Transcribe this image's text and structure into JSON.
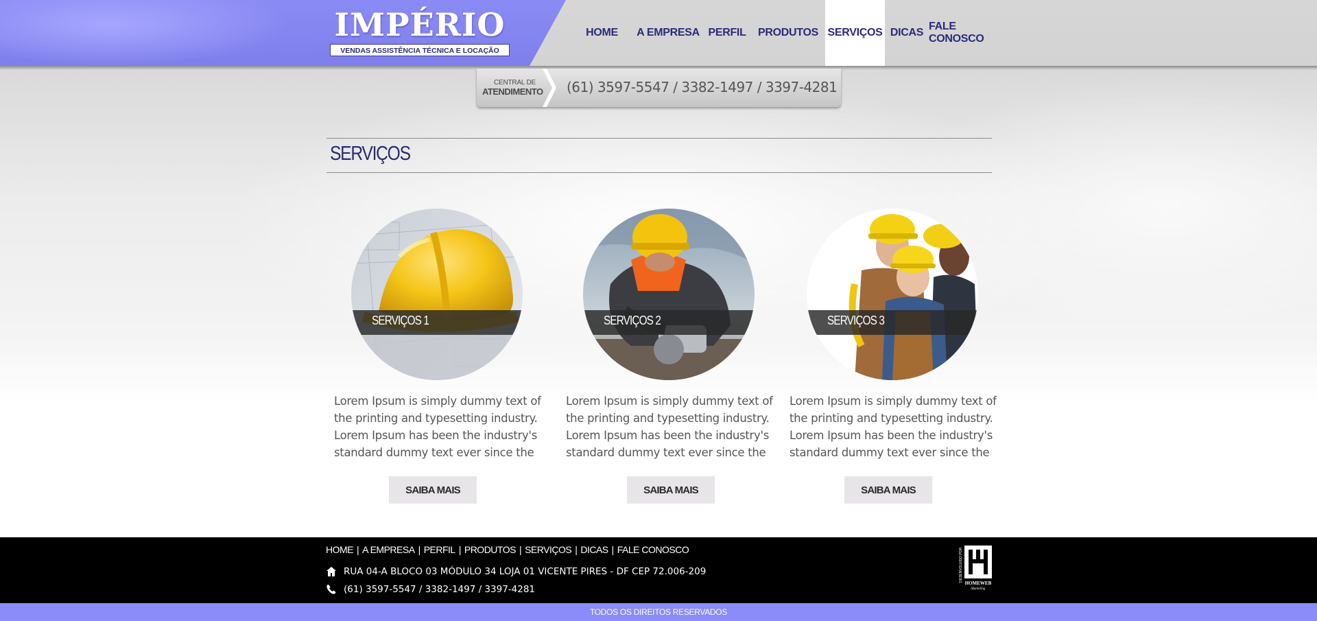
{
  "header": {
    "logo_title": "IMPÉRIO",
    "logo_tagline": "VENDAS ASSISTÊNCIA TÉCNICA E LOCAÇÃO",
    "nav": [
      {
        "label": "HOME",
        "active": false
      },
      {
        "label": "A EMPRESA",
        "active": false
      },
      {
        "label": "PERFIL",
        "active": false
      },
      {
        "label": "PRODUTOS",
        "active": false
      },
      {
        "label": "SERVIÇOS",
        "active": true
      },
      {
        "label": "DICAS",
        "active": false
      },
      {
        "label": "FALE CONOSCO",
        "active": false
      }
    ]
  },
  "contact_bar": {
    "label_line1": "CENTRAL DE",
    "label_line2": "ATENDIMENTO",
    "phones": "(61) 3597-5547 / 3382-1497 / 3397-4281"
  },
  "section": {
    "title": "SERVIÇOS"
  },
  "services": [
    {
      "label": "SERVIÇOS 1",
      "image": "hardhat-blueprint-photo",
      "text": "Lorem Ipsum is simply dummy text of the printing and typesetting industry. Lorem Ipsum has been the industry's standard dummy text ever since the",
      "button": "SAIBA MAIS"
    },
    {
      "label": "SERVIÇOS 2",
      "image": "construction-worker-photo",
      "text": "Lorem Ipsum is simply dummy text of the printing and typesetting industry. Lorem Ipsum has been the industry's standard dummy text ever since the",
      "button": "SAIBA MAIS"
    },
    {
      "label": "SERVIÇOS 3",
      "image": "workers-team-photo",
      "text": "Lorem Ipsum is simply dummy text of the printing and typesetting industry. Lorem Ipsum has been the industry's standard dummy text ever since the",
      "button": "SAIBA MAIS"
    }
  ],
  "footer": {
    "nav": [
      "HOME",
      "A EMPRESA",
      "PERFIL",
      "PRODUTOS",
      "SERVIÇOS",
      "DICAS",
      "FALE CONOSCO"
    ],
    "separator": "|",
    "address": "RUA 04-A BLOCO 03 MÓDULO 34 LOJA 01 VICENTE PIRES - DF CEP 72.006-209",
    "phones": "(61) 3597-5547 / 3382-1497 / 3397-4281",
    "dev_logo": {
      "vertical_text": "DESENVOLVIDO POR",
      "name": "HOMEWEB",
      "sub": "Marketing"
    },
    "copyright": "TODOS OS DIREITOS RESERVADOS"
  },
  "colors": {
    "brand_purple": "#8b8bf5",
    "nav_text": "#2a2a7a",
    "title_text": "#2a2a6e",
    "footer_bg": "#000000",
    "button_bg": "#e8e5e8"
  },
  "icons": {
    "address": "home-icon",
    "phone": "phone-icon"
  }
}
